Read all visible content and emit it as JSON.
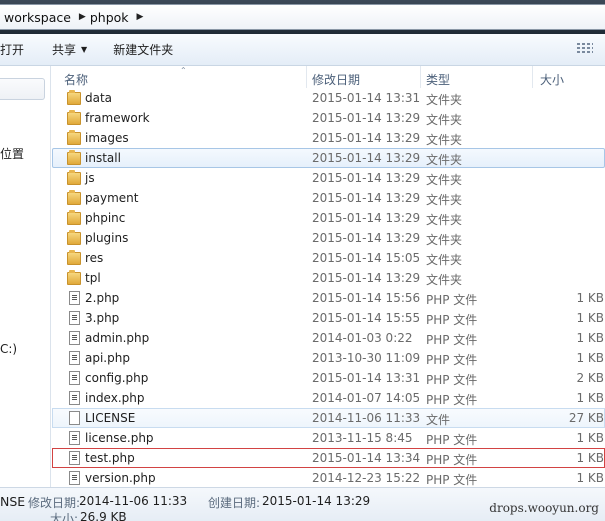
{
  "address": {
    "crumbs": [
      "workspace",
      "phpok"
    ]
  },
  "toolbar": {
    "open_label": "打开",
    "share_label": "共享",
    "new_folder_label": "新建文件夹",
    "view_icon": "view-options-icon"
  },
  "nav": {
    "item1": "位置",
    "item2": "C:)"
  },
  "columns": {
    "name": "名称",
    "date": "修改日期",
    "type": "类型",
    "size": "大小"
  },
  "files": [
    {
      "name": "data",
      "date": "2015-01-14 13:31",
      "type": "文件夹",
      "size": "",
      "kind": "folder"
    },
    {
      "name": "framework",
      "date": "2015-01-14 13:29",
      "type": "文件夹",
      "size": "",
      "kind": "folder"
    },
    {
      "name": "images",
      "date": "2015-01-14 13:29",
      "type": "文件夹",
      "size": "",
      "kind": "folder"
    },
    {
      "name": "install",
      "date": "2015-01-14 13:29",
      "type": "文件夹",
      "size": "",
      "kind": "folder"
    },
    {
      "name": "js",
      "date": "2015-01-14 13:29",
      "type": "文件夹",
      "size": "",
      "kind": "folder"
    },
    {
      "name": "payment",
      "date": "2015-01-14 13:29",
      "type": "文件夹",
      "size": "",
      "kind": "folder"
    },
    {
      "name": "phpinc",
      "date": "2015-01-14 13:29",
      "type": "文件夹",
      "size": "",
      "kind": "folder"
    },
    {
      "name": "plugins",
      "date": "2015-01-14 13:29",
      "type": "文件夹",
      "size": "",
      "kind": "folder"
    },
    {
      "name": "res",
      "date": "2015-01-14 15:05",
      "type": "文件夹",
      "size": "",
      "kind": "folder"
    },
    {
      "name": "tpl",
      "date": "2015-01-14 13:29",
      "type": "文件夹",
      "size": "",
      "kind": "folder"
    },
    {
      "name": "2.php",
      "date": "2015-01-14 15:56",
      "type": "PHP 文件",
      "size": "1 KB",
      "kind": "php"
    },
    {
      "name": "3.php",
      "date": "2015-01-14 15:55",
      "type": "PHP 文件",
      "size": "1 KB",
      "kind": "php"
    },
    {
      "name": "admin.php",
      "date": "2014-01-03 0:22",
      "type": "PHP 文件",
      "size": "1 KB",
      "kind": "php"
    },
    {
      "name": "api.php",
      "date": "2013-10-30 11:09",
      "type": "PHP 文件",
      "size": "1 KB",
      "kind": "php"
    },
    {
      "name": "config.php",
      "date": "2015-01-14 13:31",
      "type": "PHP 文件",
      "size": "2 KB",
      "kind": "php"
    },
    {
      "name": "index.php",
      "date": "2014-01-07 14:05",
      "type": "PHP 文件",
      "size": "1 KB",
      "kind": "php"
    },
    {
      "name": "LICENSE",
      "date": "2014-11-06 11:33",
      "type": "文件",
      "size": "27 KB",
      "kind": "file"
    },
    {
      "name": "license.php",
      "date": "2013-11-15 8:45",
      "type": "PHP 文件",
      "size": "1 KB",
      "kind": "php"
    },
    {
      "name": "test.php",
      "date": "2015-01-14 13:34",
      "type": "PHP 文件",
      "size": "1 KB",
      "kind": "php"
    },
    {
      "name": "version.php",
      "date": "2014-12-23 15:22",
      "type": "PHP 文件",
      "size": "1 KB",
      "kind": "php"
    }
  ],
  "details": {
    "name": "NSE",
    "modified_label": "修改日期:",
    "modified_value": "2014-11-06 11:33",
    "created_label": "创建日期:",
    "created_value": "2015-01-14 13:29",
    "size_label": "大小:",
    "size_value": "26.9 KB"
  },
  "watermark": "drops.wooyun.org",
  "colors": {
    "selection_border": "#a7c6e6",
    "highlight_box": "#d24343",
    "folder": "#e0a93a"
  }
}
